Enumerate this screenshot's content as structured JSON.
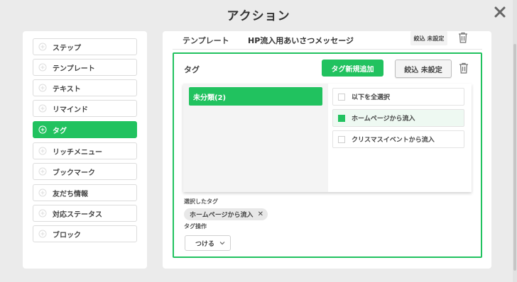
{
  "modal": {
    "title": "アクション"
  },
  "sidebar": {
    "items": [
      {
        "label": "ステップ",
        "active": false
      },
      {
        "label": "テンプレート",
        "active": false
      },
      {
        "label": "テキスト",
        "active": false
      },
      {
        "label": "リマインド",
        "active": false
      },
      {
        "label": "タグ",
        "active": true
      },
      {
        "label": "リッチメニュー",
        "active": false
      },
      {
        "label": "ブックマーク",
        "active": false
      },
      {
        "label": "友だち情報",
        "active": false
      },
      {
        "label": "対応ステータス",
        "active": false
      },
      {
        "label": "ブロック",
        "active": false
      }
    ]
  },
  "template_row": {
    "label": "テンプレート",
    "value": "HP流入用あいさつメッセージ",
    "filter_label": "絞込 未設定"
  },
  "tag_section": {
    "label": "タグ",
    "new_tag_button": "タグ新規追加",
    "filter_button": "絞込 未設定",
    "folders": [
      {
        "label": "未分類(2)",
        "selected": true
      }
    ],
    "tags": [
      {
        "label": "以下を全選択",
        "checked": false
      },
      {
        "label": "ホームページから流入",
        "checked": true
      },
      {
        "label": "クリスマスイベントから流入",
        "checked": false
      }
    ],
    "selected_label": "選択したタグ",
    "selected_tags": [
      "ホームページから流入"
    ],
    "operation_label": "タグ操作",
    "operation_value": "つける"
  },
  "colors": {
    "accent": "#21c25f",
    "background": "#ebebeb"
  }
}
